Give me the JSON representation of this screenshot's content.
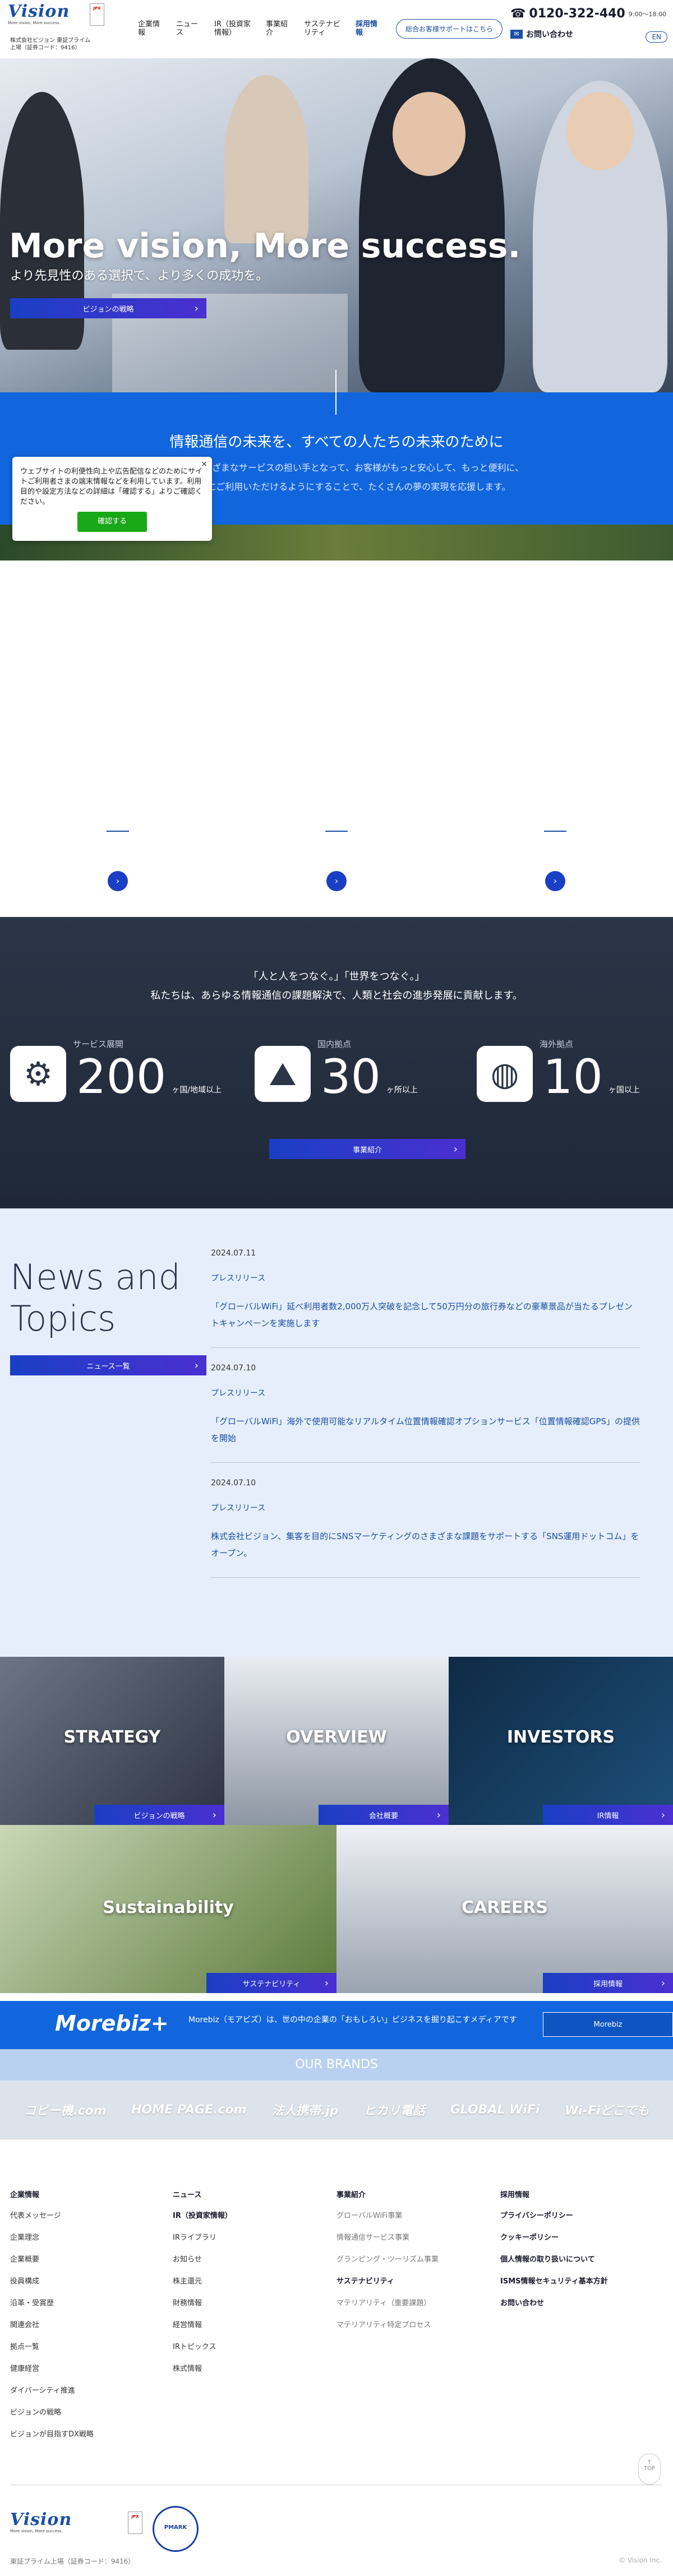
{
  "header": {
    "logo": "Vision",
    "logo_tagline": "More vision, More success.",
    "jpx_badge": "JPX",
    "listing": "株式会社ビジョン 東証プライム上場（証券コード：9416）",
    "nav": [
      "企業情報",
      "ニュース",
      "IR（投資家情報）",
      "事業紹介",
      "サステナビリティ",
      "採用情報"
    ],
    "support_button": "総合お客様サポートはこちら",
    "tel": "0120-322-440",
    "tel_hours": "9:00〜18:00",
    "contact": "お問い合わせ",
    "lang": "EN"
  },
  "hero": {
    "title": "More vision, More success.",
    "subtitle": "より先見性のある選択で、より多くの成功を。",
    "button": "ビジョンの戦略"
  },
  "mission": {
    "title": "情報通信の未来を、すべての人たちの未来のために",
    "body_1": "私たちは、さまざまなサービスの担い手となって、お客様がもっと安心して、もっと便利に、",
    "body_2": "もっと快適にご利用いただけるようにすることで、たくさんの夢の実現を応援します。"
  },
  "cookie": {
    "text": "ウェブサイトの利便性向上や広告配信などのためにサイトご利用者さまの端末情報などを利用しています。利用目的や設定方法などの詳細は「確認する」よりご確認ください。",
    "close": "×",
    "button": "確認する"
  },
  "numbers": {
    "tagline_1": "「人と人をつなぐ。」「世界をつなぐ。」",
    "tagline_2": "私たちは、あらゆる情報通信の課題解決で、人類と社会の進歩発展に貢献します。",
    "stats": [
      {
        "label": "サービス展開",
        "value": "200",
        "unit": "ヶ国/地域以上",
        "icon": "globe-hand-icon"
      },
      {
        "label": "国内拠点",
        "value": "30",
        "unit": "ヶ所以上",
        "icon": "japan-map-icon"
      },
      {
        "label": "海外拠点",
        "value": "10",
        "unit": "ヶ国以上",
        "icon": "globe-icon"
      }
    ],
    "button": "事業紹介"
  },
  "news": {
    "title_1": "News and",
    "title_2": "Topics",
    "button": "ニュース一覧",
    "items": [
      {
        "date": "2024.07.11",
        "category": "プレスリリース",
        "text": "「グローバルWiFi」延べ利用者数2,000万人突破を記念して50万円分の旅行券などの豪華景品が当たるプレゼントキャンペーンを実施します"
      },
      {
        "date": "2024.07.10",
        "category": "プレスリリース",
        "text": "「グローバルWiFi」海外で使用可能なリアルタイム位置情報確認オプションサービス「位置情報確認GPS」の提供を開始"
      },
      {
        "date": "2024.07.10",
        "category": "プレスリリース",
        "text": "株式会社ビジョン、集客を目的にSNSマーケティングのさまざまな課題をサポートする「SNS運用ドットコム」をオープン。"
      }
    ]
  },
  "tiles": [
    {
      "label": "STRATEGY",
      "button": "ビジョンの戦略"
    },
    {
      "label": "OVERVIEW",
      "button": "会社概要"
    },
    {
      "label": "INVESTORS",
      "button": "IR情報"
    },
    {
      "label": "Sustainability",
      "button": "サステナビリティ"
    },
    {
      "label": "CAREERS",
      "button": "採用情報"
    }
  ],
  "morebiz": {
    "logo": "Morebiz+",
    "text": "Morebiz（モアビズ）は、世の中の企業の「おもしろい」ビジネスを掘り起こすメディアです",
    "button": "Morebiz"
  },
  "brands": {
    "title": "OUR BRANDS",
    "items": [
      "コピー機.com",
      "HOME PAGE.com",
      "法人携帯.jp",
      "ヒカリ電話",
      "GLOBAL WiFi",
      "Wi-Fiどこでも"
    ]
  },
  "footer": {
    "col1": {
      "head": "企業情報",
      "links": [
        "代表メッセージ",
        "企業理念",
        "企業概要",
        "役員構成",
        "沿革・受賞歴",
        "関連会社",
        "拠点一覧",
        "健康経営",
        "ダイバーシティ推進",
        "ビジョンの戦略",
        "ビジョンが目指すDX戦略"
      ]
    },
    "col2": {
      "head": "ニュース",
      "links": [
        "IR（投資家情報）",
        "IRライブラリ",
        "お知らせ",
        "株主還元",
        "財務情報",
        "経営情報",
        "IRトピックス",
        "株式情報"
      ]
    },
    "col3": {
      "head": "事業紹介",
      "links": [
        "グローバルWiFi事業",
        "情報通信サービス事業",
        "グランピング・ツーリズム事業",
        "サステナビリティ",
        "マテリアリティ（重要課題）",
        "マテリアリティ特定プロセス"
      ]
    },
    "col4": {
      "head": "採用情報",
      "links": [
        "プライバシーポリシー",
        "クッキーポリシー",
        "個人情報の取り扱いについて",
        "ISMS情報セキュリティ基本方針",
        "お問い合わせ"
      ]
    },
    "top": "TOP",
    "listing": "東証プライム上場（証券コード：9416）",
    "copyright": "© Vision Inc."
  }
}
